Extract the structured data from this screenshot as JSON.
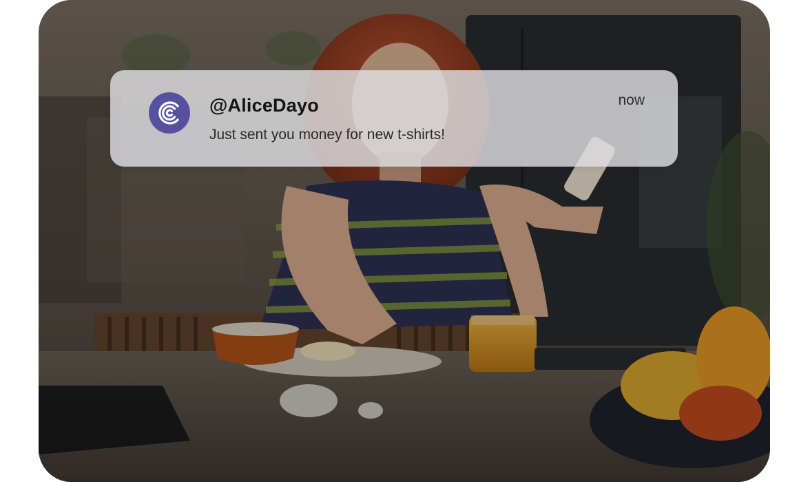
{
  "colors": {
    "avatar_bg": "#56519e",
    "notification_bg": "#dedee2",
    "page_bg": "#ffffff"
  },
  "background": {
    "icon": "kitchen-photo"
  },
  "notification": {
    "app_icon": "payment-app-logo-icon",
    "sender": "@AliceDayo",
    "message": "Just sent you money for new t-shirts!",
    "time": "now"
  }
}
